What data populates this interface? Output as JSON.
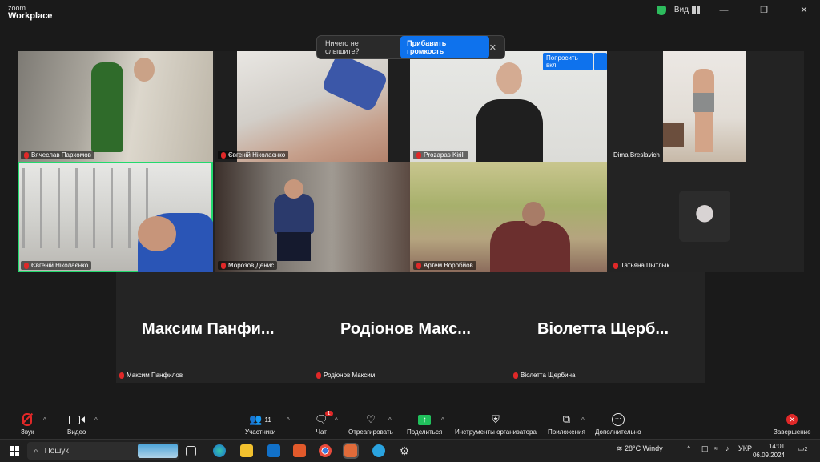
{
  "app": {
    "logo_small": "zoom",
    "logo_big": "Workplace"
  },
  "topbar": {
    "view_label": "Вид"
  },
  "notice": {
    "text": "Ничего не слышите?",
    "button": "Прибавить громкость",
    "close": "✕"
  },
  "tiles": [
    {
      "name": "Вячеслав Пархомов"
    },
    {
      "name": "Євгеній Ніколаєнко"
    },
    {
      "name": "Prozapas Kirill",
      "ask": "Попросить вкл",
      "more": "···"
    },
    {
      "name": "Dima Breslavich"
    },
    {
      "name": "Євгеній Ніколаєнко"
    },
    {
      "name": "Морозов Денис"
    },
    {
      "name": "Артем Воробйов"
    },
    {
      "name": "Татьяна Пытлык"
    }
  ],
  "lower": [
    {
      "big": "Максим  Панфи...",
      "small": "Максим Панфилов"
    },
    {
      "big": "Родіонов  Макс...",
      "small": "Родіонов Максим"
    },
    {
      "big": "Віолетта  Щерб...",
      "small": "Віолетта Щербина"
    }
  ],
  "toolbar": {
    "audio": "Звук",
    "video": "Видео",
    "participants": "Участники",
    "participants_count": "11",
    "chat": "Чат",
    "chat_badge": "1",
    "react": "Отреагировать",
    "share": "Поделиться",
    "host_tools": "Инструменты организатора",
    "apps": "Приложения",
    "more": "Дополнительно",
    "end": "Завершение"
  },
  "taskbar": {
    "search": "Пошук",
    "weather": "28°C  Windy",
    "lang": "УКР",
    "time": "14:01",
    "date": "06.09.2024",
    "notif_count": "2"
  }
}
